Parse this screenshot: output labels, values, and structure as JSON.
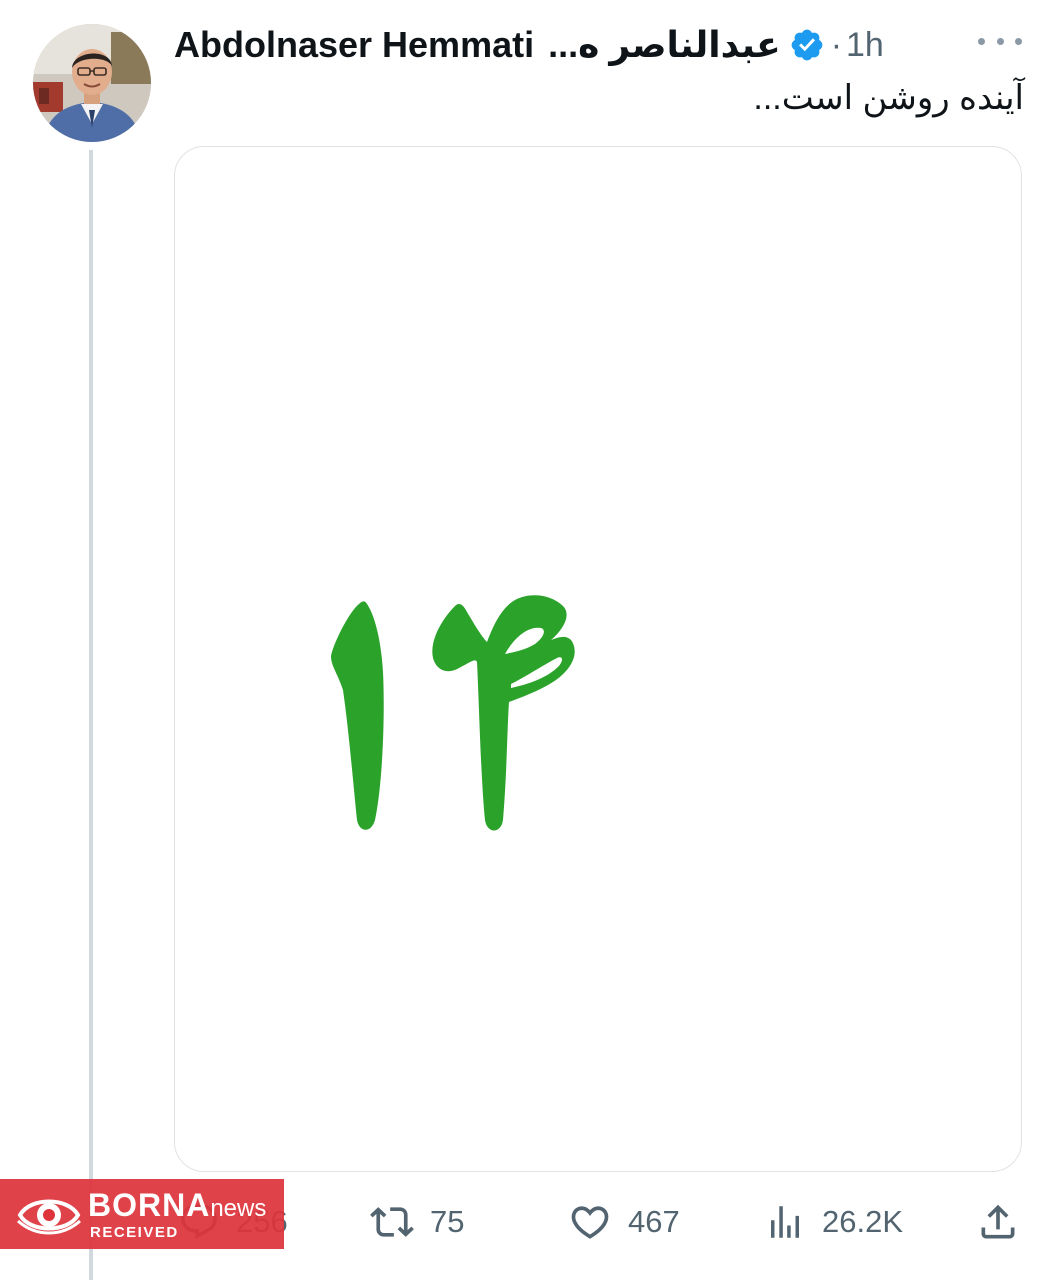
{
  "tweet": {
    "display_name": "Abdolnaser Hemmati",
    "display_name_fa": "عبدالناصر ه...",
    "separator": "·",
    "time": "1h",
    "text": "آینده روشن است...",
    "media": {
      "number_text": "۱۴",
      "number_color": "#2ba32b",
      "background": "#ffffff"
    },
    "actions": {
      "replies": "256",
      "reposts": "75",
      "likes": "467",
      "views": "26.2K"
    }
  },
  "icons": {
    "verified": "verified-badge-icon",
    "more": "more-options-icon",
    "reply": "reply-icon",
    "repost": "repost-icon",
    "like": "heart-icon",
    "views": "views-icon",
    "share": "share-icon"
  },
  "colors": {
    "verified": "#1d9bf0",
    "muted_text": "#536471",
    "thread_line": "#cfd9de",
    "watermark_bg": "#de343c"
  },
  "watermark": {
    "brand": "BORNA",
    "suffix": "news",
    "subtitle": "RECEIVED"
  }
}
